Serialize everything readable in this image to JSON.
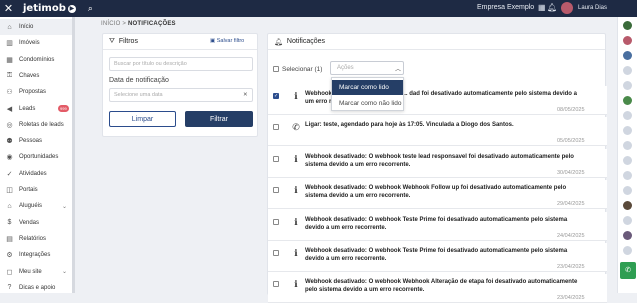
{
  "topbar": {
    "close_icon": "close-icon",
    "logo": "jetimob",
    "company": "Empresa Exemplo",
    "user": "Laura Dias"
  },
  "sidebar": {
    "items": [
      {
        "label": "Início",
        "icon": "home-icon"
      },
      {
        "label": "Imóveis",
        "icon": "building-icon"
      },
      {
        "label": "Condomínios",
        "icon": "condo-icon"
      },
      {
        "label": "Chaves",
        "icon": "key-icon"
      },
      {
        "label": "Propostas",
        "icon": "handshake-icon"
      },
      {
        "label": "Leads",
        "icon": "megaphone-icon",
        "badge": "999"
      },
      {
        "label": "Roletas de leads",
        "icon": "roulette-icon"
      },
      {
        "label": "Pessoas",
        "icon": "people-icon"
      },
      {
        "label": "Oportunidades",
        "icon": "target-icon"
      },
      {
        "label": "Atividades",
        "icon": "check-circle-icon"
      },
      {
        "label": "Portais",
        "icon": "portal-icon"
      },
      {
        "label": "Aluguéis",
        "icon": "rent-icon"
      },
      {
        "label": "Vendas",
        "icon": "sales-icon"
      },
      {
        "label": "Relatórios",
        "icon": "report-icon"
      },
      {
        "label": "Integrações",
        "icon": "integration-icon"
      },
      {
        "label": "Meu site",
        "icon": "website-icon"
      },
      {
        "label": "Dicas e apoio",
        "icon": "help-icon"
      }
    ]
  },
  "breadcrumb": {
    "root": "INÍCIO",
    "sep": ">",
    "current": "NOTIFICAÇÕES"
  },
  "filters": {
    "title": "Filtros",
    "save_label": "Salvar filtro",
    "search_placeholder": "Buscar por título ou descrição",
    "date_label": "Data de notificação",
    "date_placeholder": "Selecione uma data",
    "clear_label": "Limpar",
    "filter_label": "Filtrar"
  },
  "notifications": {
    "title": "Notificações",
    "select_label": "Selecionar (1)",
    "actions_placeholder": "Ações",
    "dropdown": [
      "Marcar como lido",
      "Marcar como não lido"
    ],
    "items": [
      {
        "checked": true,
        "icon": "info-icon",
        "text": "Webhook desativado: O webhook ... dad foi desativado automaticamente pelo sistema devido a um erro recorrente.",
        "date": "08/05/2025"
      },
      {
        "checked": false,
        "icon": "phone-icon",
        "text": "Ligar: teste, agendado para hoje às 17:05. Vinculada a Diogo dos Santos.",
        "date": "05/05/2025"
      },
      {
        "checked": false,
        "icon": "info-icon",
        "text": "Webhook desativado: O webhook teste lead responsavel foi desativado automaticamente pelo sistema devido a um erro recorrente.",
        "date": "30/04/2025"
      },
      {
        "checked": false,
        "icon": "info-icon",
        "text": "Webhook desativado: O webhook Webhook Follow up foi desativado automaticamente pelo sistema devido a um erro recorrente.",
        "date": "29/04/2025"
      },
      {
        "checked": false,
        "icon": "info-icon",
        "text": "Webhook desativado: O webhook Teste Prime foi desativado automaticamente pelo sistema devido a um erro recorrente.",
        "date": "24/04/2025"
      },
      {
        "checked": false,
        "icon": "info-icon",
        "text": "Webhook desativado: O webhook Teste Prime foi desativado automaticamente pelo sistema devido a um erro recorrente.",
        "date": "23/04/2025"
      },
      {
        "checked": false,
        "icon": "info-icon",
        "text": "Webhook desativado: O webhook Webhook Alteração de etapa foi desativado automaticamente pelo sistema devido a um erro recorrente.",
        "date": "23/04/2025"
      }
    ]
  },
  "colors": {
    "topbar": "#1e2a44",
    "accent": "#253e66",
    "badge": "#e35b67",
    "whatsapp": "#2e9e52"
  }
}
